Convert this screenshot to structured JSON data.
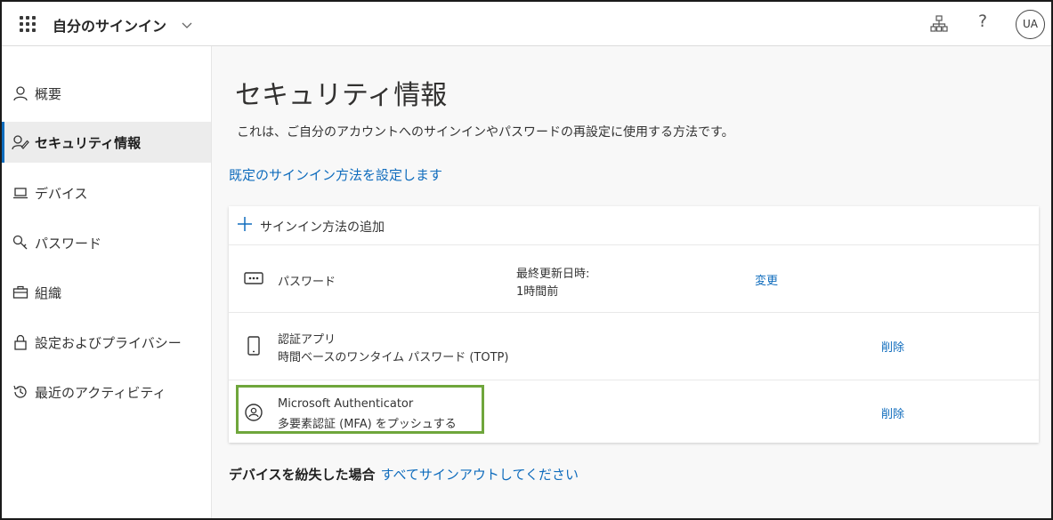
{
  "header": {
    "app_title": "自分のサインイン",
    "icons": [
      "waffle-icon",
      "chevron-down-icon",
      "org-chart-icon",
      "help-icon"
    ],
    "help_glyph": "?",
    "avatar_initials": "UA"
  },
  "sidebar": {
    "items": [
      {
        "label": "概要",
        "icon": "person-icon",
        "active": false
      },
      {
        "label": "セキュリティ情報",
        "icon": "security-info-icon",
        "active": true
      },
      {
        "label": "デバイス",
        "icon": "laptop-icon",
        "active": false
      },
      {
        "label": "パスワード",
        "icon": "key-icon",
        "active": false
      },
      {
        "label": "組織",
        "icon": "briefcase-icon",
        "active": false
      },
      {
        "label": "設定およびプライバシー",
        "icon": "lock-icon",
        "active": false
      },
      {
        "label": "最近のアクティビティ",
        "icon": "history-icon",
        "active": false
      }
    ]
  },
  "main": {
    "title": "セキュリティ情報",
    "description": "これは、ご自分のアカウントへのサインインやパスワードの再設定に使用する方法です。",
    "default_method_link": "既定のサインイン方法を設定します",
    "add_method_label": "サインイン方法の追加",
    "methods": [
      {
        "name": "パスワード",
        "icon": "password-dots-icon",
        "last_updated_label": "最終更新日時:",
        "last_updated_value": "1時間前",
        "action": "変更"
      },
      {
        "name": "認証アプリ",
        "subtitle": "時間ベースのワンタイム パスワード (TOTP)",
        "icon": "phone-icon",
        "action": "削除"
      },
      {
        "name": "Microsoft Authenticator",
        "subtitle": "多要素認証 (MFA) をプッシュする",
        "icon": "authenticator-icon",
        "action": "削除",
        "highlighted": true
      }
    ],
    "lost_device_label": "デバイスを紛失した場合",
    "lost_device_link": "すべてサインアウトしてください"
  },
  "colors": {
    "accent": "#0f6cbd",
    "highlight_border": "#6fa63c",
    "main_bg": "#f8f8f8",
    "active_nav_bg": "#ececec"
  }
}
